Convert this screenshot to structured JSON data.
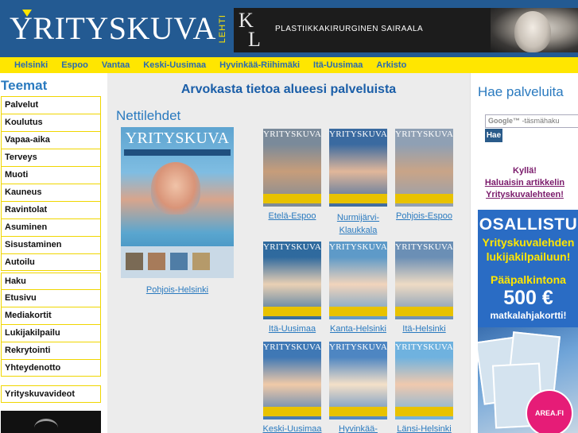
{
  "header": {
    "logo_text": "YRITYSKUVA",
    "logo_sub": "LEHTI",
    "banner_text": "PLASTIIKKAKIRURGINEN SAIRAALA"
  },
  "nav": {
    "items": [
      "Helsinki",
      "Espoo",
      "Vantaa",
      "Keski-Uusimaa",
      "Hyvinkää-Riihimäki",
      "Itä-Uusimaa",
      "Arkisto"
    ]
  },
  "left": {
    "heading": "Teemat",
    "menu1": [
      "Palvelut",
      "Koulutus",
      "Vapaa-aika",
      "Terveys",
      "Muoti",
      "Kauneus",
      "Ravintolat",
      "Asuminen",
      "Sisustaminen",
      "Autoilu"
    ],
    "menu2": [
      "Haku"
    ],
    "menu3": [
      "Etusivu",
      "Mediakortit",
      "Lukijakilpailu",
      "Rekrytointi",
      "Yhteydenotto"
    ],
    "menu4": [
      "Yrityskuvavideot"
    ]
  },
  "center": {
    "title": "Arvokasta tietoa alueesi palveluista",
    "section": "Nettilehdet",
    "big_cover_label": "Pohjois-Helsinki",
    "covers": [
      {
        "label": "Etelä-Espoo"
      },
      {
        "label": "Nurmijärvi-Klaukkala"
      },
      {
        "label": "Pohjois-Espoo"
      },
      {
        "label": "Itä-Uusimaa"
      },
      {
        "label": "Kanta-Helsinki"
      },
      {
        "label": "Itä-Helsinki"
      },
      {
        "label": "Keski-Uusimaa"
      },
      {
        "label": "Hyvinkää-"
      },
      {
        "label": "Länsi-Helsinki"
      }
    ],
    "cover_mast": "YRITYSKUVA"
  },
  "right": {
    "heading": "Hae palveluita",
    "search_brand": "Google™",
    "search_placeholder": "-täsmähaku",
    "search_button": "Hae",
    "promo": [
      "Kyllä!",
      "Haluaisin artikkelin",
      "Yrityskuvalehteen!"
    ],
    "ad": {
      "line1": "OSALLISTU",
      "line2": "Yrityskuvalehden lukijakilpailuun!",
      "line3": "Pääpalkintona",
      "line4": "500 €",
      "line5": "matkalahjakortti!"
    },
    "badge": "AREA.FI"
  },
  "colors": {
    "header_blue": "#235a92",
    "nav_yellow": "#ffe600",
    "link_blue": "#2a7abf",
    "promo_purple": "#7a1a6b",
    "ad_blue": "#2a6cc4",
    "badge_pink": "#e61c77"
  }
}
